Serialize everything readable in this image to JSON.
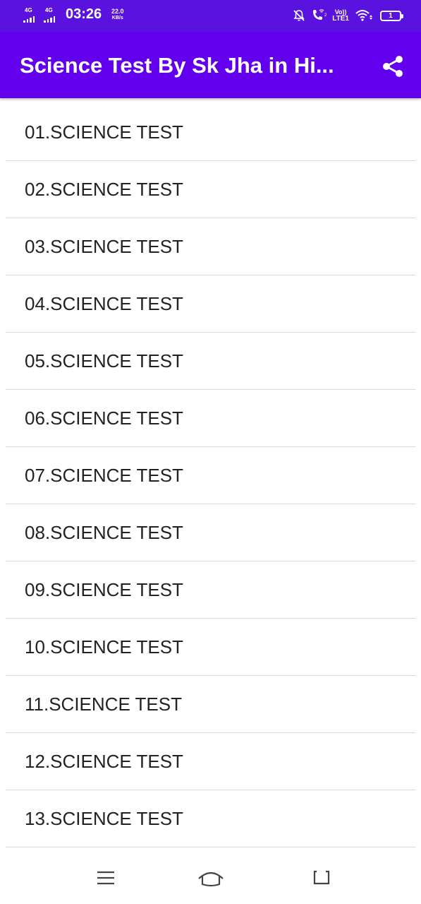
{
  "status_bar": {
    "sim1_network": "4G",
    "sim2_network": "4G",
    "time": "03:26",
    "speed_value": "22.0",
    "speed_unit": "KB/s",
    "volte_top": "Vo))",
    "volte_bottom": "LTE1",
    "battery_level": "1",
    "icons": [
      "signal-bars-icon",
      "mute-bell-icon",
      "wifi-calling-icon",
      "wifi-icon",
      "battery-icon"
    ]
  },
  "app_bar": {
    "title": "Science Test By Sk Jha in Hi...",
    "share_icon": "share-icon",
    "color": "#6200ee"
  },
  "list": {
    "items": [
      {
        "label": "01.SCIENCE TEST"
      },
      {
        "label": "02.SCIENCE TEST"
      },
      {
        "label": "03.SCIENCE TEST"
      },
      {
        "label": "04.SCIENCE TEST"
      },
      {
        "label": "05.SCIENCE TEST"
      },
      {
        "label": "06.SCIENCE TEST"
      },
      {
        "label": "07.SCIENCE TEST"
      },
      {
        "label": "08.SCIENCE TEST"
      },
      {
        "label": "09.SCIENCE TEST"
      },
      {
        "label": "10.SCIENCE TEST"
      },
      {
        "label": "11.SCIENCE TEST"
      },
      {
        "label": "12.SCIENCE TEST"
      },
      {
        "label": "13.SCIENCE TEST"
      }
    ]
  },
  "nav_bar": {
    "icons": [
      "menu-icon",
      "home-icon",
      "back-icon"
    ]
  }
}
